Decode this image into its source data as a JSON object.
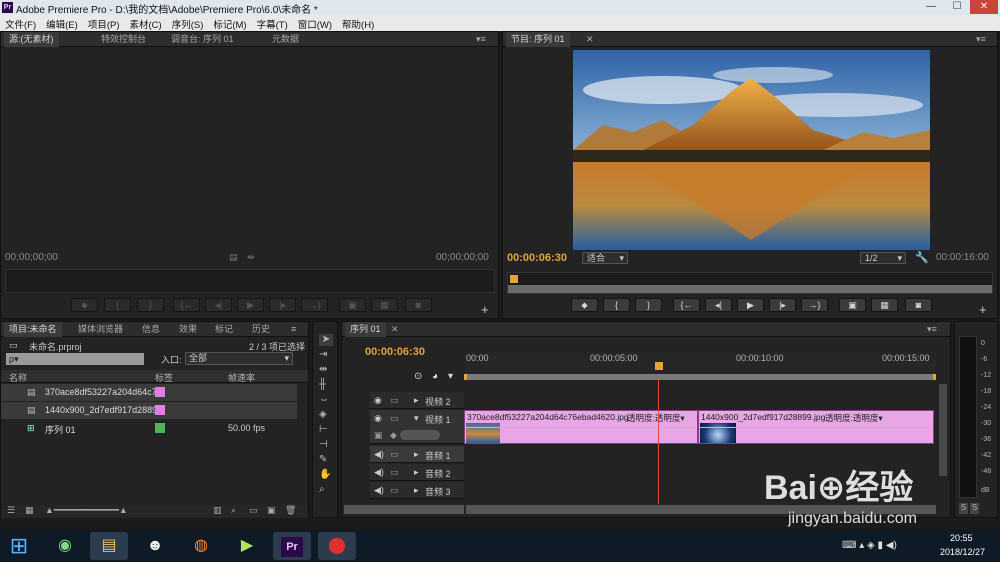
{
  "window": {
    "title": "Adobe Premiere Pro - D:\\我的文档\\Adobe\\Premiere Pro\\6.0\\未命名 *",
    "icon_text": "Pr",
    "min": "—",
    "max": "☐",
    "close": "✕"
  },
  "menu": [
    "文件(F)",
    "编辑(E)",
    "项目(P)",
    "素材(C)",
    "序列(S)",
    "标记(M)",
    "字幕(T)",
    "窗口(W)",
    "帮助(H)"
  ],
  "source_panel": {
    "tabs": [
      "源:(无素材)",
      "特效控制台",
      "调音台: 序列 01",
      "元数据"
    ],
    "tc_left": "00;00;00;00",
    "tc_right": "00;00;00;00"
  },
  "program_panel": {
    "tab": "节目: 序列 01",
    "tc_current": "00:00:06:30",
    "fit": "适合",
    "res": "1/2",
    "tc_duration": "00:00:16:00"
  },
  "project_panel": {
    "tabs": [
      "项目:未命名",
      "媒体浏览器",
      "信息",
      "效果",
      "标记",
      "历史"
    ],
    "project_file": "未命名.prproj",
    "selection": "2 / 3 项已选择",
    "search_placeholder": "ρ▾",
    "entry_label": "入口:",
    "entry_value": "全部",
    "col_name": "名称",
    "col_label": "标签",
    "col_fps": "帧速率",
    "items": [
      {
        "name": "370ace8df53227a204d64c7",
        "label_color": "#e37ee5",
        "fps": ""
      },
      {
        "name": "1440x900_2d7edf917d2889",
        "label_color": "#e37ee5",
        "fps": ""
      },
      {
        "name": "序列 01",
        "label_color": "#4fb35a",
        "fps": "50.00 fps"
      }
    ]
  },
  "timeline": {
    "tab": "序列 01",
    "tc": "00:00:06:30",
    "ruler": [
      "00:00",
      "00:00:05:00",
      "00:00:10:00",
      "00:00:15:00"
    ],
    "tracks": {
      "v2": "视频 2",
      "v1": "视频 1",
      "a1": "音频 1",
      "a2": "音频 2",
      "a3": "音频 3"
    },
    "clips": [
      {
        "name": "370ace8df53227a204d64c76ebad4620.jpg",
        "fx": "透明度:透明度▾"
      },
      {
        "name": "1440x900_2d7edf917d28899.jpg",
        "fx": "透明度:透明度▾"
      }
    ]
  },
  "meter": {
    "labels": [
      "0",
      "-6",
      "-12",
      "-18",
      "-24",
      "-30",
      "-36",
      "-42",
      "-48",
      "dB"
    ],
    "solo": [
      "S",
      "S"
    ]
  },
  "tray": {
    "time": "20:55",
    "date": "2018/12/27"
  },
  "watermark": {
    "text": "Bai⊕经验",
    "url": "jingyan.baidu.com"
  }
}
